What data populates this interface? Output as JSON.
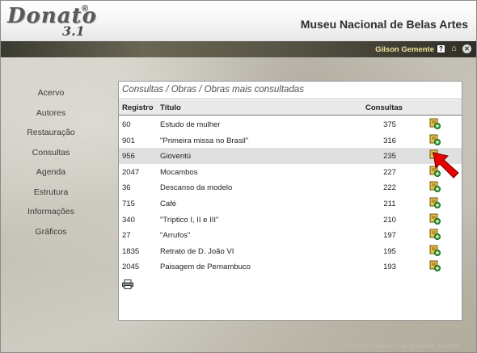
{
  "header": {
    "logo_word": "Donato",
    "logo_version": "3.1",
    "logo_reg": "®",
    "museum_name": "Museu Nacional de Belas Artes"
  },
  "topbar": {
    "user_name": "Gilson Gemente",
    "help_glyph": "?",
    "home_glyph": "⌂",
    "close_glyph": "✕"
  },
  "nav": [
    "Acervo",
    "Autores",
    "Restauração",
    "Consultas",
    "Agenda",
    "Estrutura",
    "Informações",
    "Gráficos"
  ],
  "panel": {
    "breadcrumb": "Consultas / Obras / Obras mais consultadas",
    "columns": {
      "registro": "Registro",
      "titulo": "Título",
      "consultas": "Consultas"
    },
    "rows": [
      {
        "registro": "60",
        "titulo": "Estudo de mulher",
        "consultas": "375"
      },
      {
        "registro": "901",
        "titulo": "\"Primeira missa no Brasil\"",
        "consultas": "316"
      },
      {
        "registro": "956",
        "titulo": "Gioventú",
        "consultas": "235"
      },
      {
        "registro": "2047",
        "titulo": "Mocambos",
        "consultas": "227"
      },
      {
        "registro": "36",
        "titulo": "Descanso da modelo",
        "consultas": "222"
      },
      {
        "registro": "715",
        "titulo": "Café",
        "consultas": "211"
      },
      {
        "registro": "340",
        "titulo": "\"Tríptico I, II e III\"",
        "consultas": "210"
      },
      {
        "registro": "27",
        "titulo": "\"Arrufos\"",
        "consultas": "197"
      },
      {
        "registro": "1835",
        "titulo": "Retrato de D. João VI",
        "consultas": "195"
      },
      {
        "registro": "2045",
        "titulo": "Paisagem de Pernambuco",
        "consultas": "193"
      }
    ],
    "highlighted_row": 2
  },
  "footer": "9 acessos desde 1º de fevereiro de 2005",
  "colors": {
    "accent_user": "#f2e49a",
    "arrow": "#e60000",
    "row_highlight": "#e0e0e0",
    "doc_icon": "#e8c24a",
    "doc_plus": "#2e9a2e"
  }
}
